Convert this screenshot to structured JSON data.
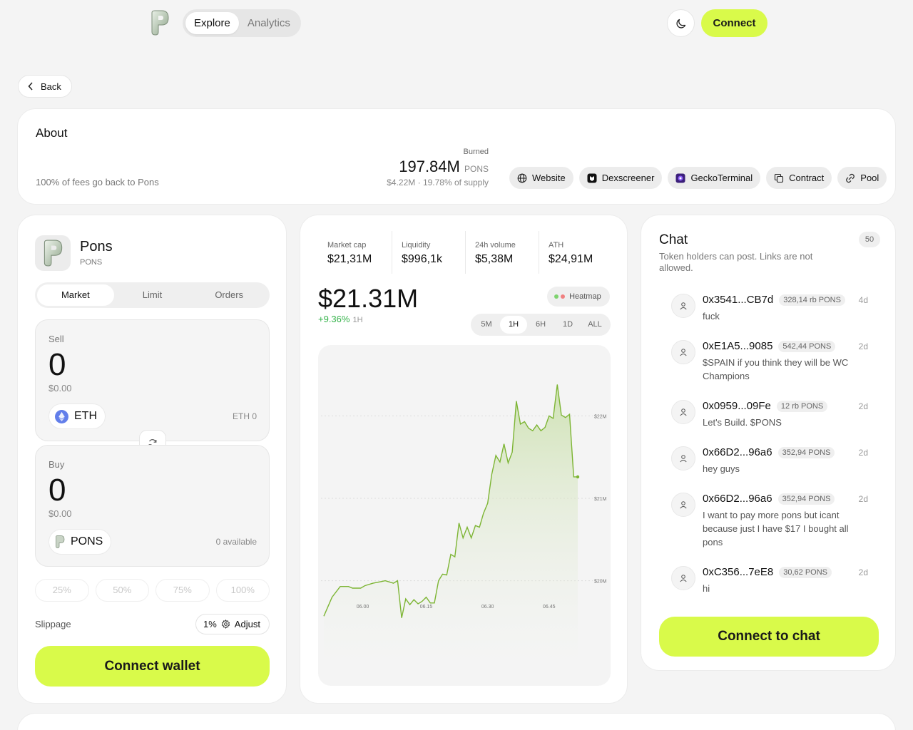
{
  "nav": {
    "tabs": [
      {
        "label": "Explore"
      },
      {
        "label": "Analytics"
      }
    ],
    "connect_label": "Connect"
  },
  "back_label": "Back",
  "about": {
    "title": "About",
    "description": "100% of fees go back to Pons",
    "burned_label": "Burned",
    "burned_value": "197.84M",
    "burned_unit": "PONS",
    "burned_usd": "$4.22M",
    "burned_supply": "19.78% of supply",
    "links": [
      {
        "label": "Website"
      },
      {
        "label": "Dexscreener"
      },
      {
        "label": "GeckoTerminal"
      },
      {
        "label": "Contract"
      },
      {
        "label": "Pool"
      }
    ]
  },
  "token": {
    "name": "Pons",
    "symbol": "PONS"
  },
  "swap": {
    "tabs": [
      {
        "label": "Market"
      },
      {
        "label": "Limit"
      },
      {
        "label": "Orders"
      }
    ],
    "sell": {
      "label": "Sell",
      "amount": "0",
      "usd": "$0.00",
      "token": "ETH",
      "balance": "ETH 0"
    },
    "buy": {
      "label": "Buy",
      "amount": "0",
      "usd": "$0.00",
      "token": "PONS",
      "balance": "0 available"
    },
    "percents": [
      {
        "label": "25%"
      },
      {
        "label": "50%"
      },
      {
        "label": "75%"
      },
      {
        "label": "100%"
      }
    ],
    "slippage_label": "Slippage",
    "slippage_value": "1%",
    "adjust_label": "Adjust",
    "connect_wallet_label": "Connect wallet"
  },
  "market": {
    "stats": [
      {
        "label": "Market cap",
        "value": "$21,31M"
      },
      {
        "label": "Liquidity",
        "value": "$996,1k"
      },
      {
        "label": "24h volume",
        "value": "$5,38M"
      },
      {
        "label": "ATH",
        "value": "$24,91M"
      }
    ],
    "price": "$21.31M",
    "change": "+9.36%",
    "change_period": "1H",
    "heatmap_label": "Heatmap",
    "ranges": [
      {
        "label": "5M"
      },
      {
        "label": "1H"
      },
      {
        "label": "6H"
      },
      {
        "label": "1D"
      },
      {
        "label": "ALL"
      }
    ],
    "line_color": "#7db534",
    "up_color": "#35b34a"
  },
  "chart_data": {
    "type": "area",
    "y_ticks": [
      "$22M",
      "$21M",
      "$20M"
    ],
    "x_ticks": [
      "06.00",
      "06.15",
      "06.30",
      "06.45"
    ],
    "ylim": [
      19.4,
      22.6
    ],
    "x_range": [
      0,
      62
    ],
    "grid": true,
    "series": [
      {
        "x": [
          0,
          2,
          4,
          6,
          7,
          9,
          10,
          12,
          14,
          15,
          17,
          18,
          19,
          20,
          21,
          22,
          23,
          24,
          25,
          26,
          27,
          28,
          29,
          30,
          31,
          32,
          33,
          34,
          35,
          36,
          37,
          38,
          39,
          40,
          41,
          42,
          43,
          44,
          45,
          46,
          47,
          48,
          49,
          50,
          51,
          52,
          53,
          54,
          55,
          56,
          57,
          58,
          59,
          60,
          61,
          62
        ],
        "y": [
          19.57,
          19.8,
          19.93,
          19.93,
          19.91,
          19.91,
          19.94,
          19.97,
          19.99,
          20.0,
          19.97,
          20.0,
          19.55,
          19.78,
          19.71,
          19.77,
          19.72,
          19.75,
          19.8,
          19.73,
          19.73,
          20.0,
          20.08,
          20.07,
          20.32,
          20.29,
          20.7,
          20.52,
          20.65,
          20.52,
          20.67,
          20.65,
          20.82,
          20.94,
          21.29,
          21.52,
          21.44,
          21.66,
          21.43,
          21.56,
          22.18,
          21.9,
          21.93,
          21.85,
          21.82,
          21.89,
          21.82,
          21.86,
          22.0,
          21.97,
          22.38,
          22.01,
          21.98,
          22.02,
          21.26,
          21.26
        ]
      }
    ]
  },
  "chat": {
    "title": "Chat",
    "count": "50",
    "description": "Token holders can post. Links are not allowed.",
    "messages": [
      {
        "address": "0x3541...CB7d",
        "balance": "328,14 rb PONS",
        "time": "4d",
        "text": "fuck"
      },
      {
        "address": "0xE1A5...9085",
        "balance": "542,44 PONS",
        "time": "2d",
        "text": "$SPAIN if you think they will be WC Champions"
      },
      {
        "address": "0x0959...09Fe",
        "balance": "12 rb PONS",
        "time": "2d",
        "text": "Let's Build. $PONS"
      },
      {
        "address": "0x66D2...96a6",
        "balance": "352,94 PONS",
        "time": "2d",
        "text": "hey guys"
      },
      {
        "address": "0x66D2...96a6",
        "balance": "352,94 PONS",
        "time": "2d",
        "text": "I want to pay more pons but icant because just I have $17 I bought all pons"
      },
      {
        "address": "0xC356...7eE8",
        "balance": "30,62 PONS",
        "time": "2d",
        "text": "hi"
      }
    ],
    "connect_label": "Connect to chat"
  }
}
